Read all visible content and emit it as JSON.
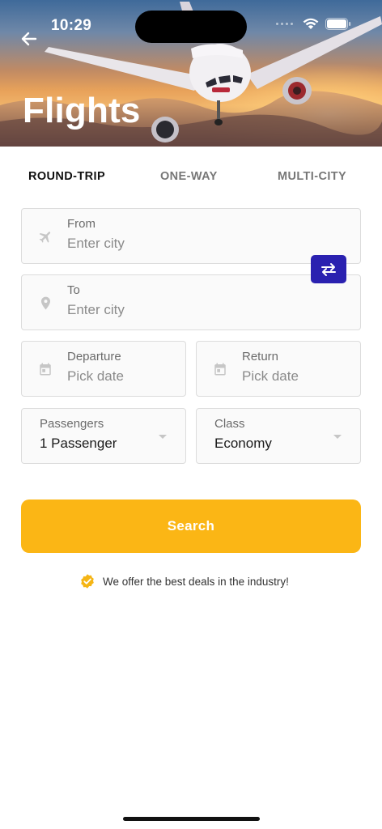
{
  "status_bar": {
    "time": "10:29"
  },
  "header": {
    "title": "Flights"
  },
  "tabs": [
    {
      "label": "ROUND-TRIP",
      "active": true
    },
    {
      "label": "ONE-WAY",
      "active": false
    },
    {
      "label": "MULTI-CITY",
      "active": false
    }
  ],
  "form": {
    "from": {
      "label": "From",
      "placeholder": "Enter city",
      "icon": "plane-icon"
    },
    "to": {
      "label": "To",
      "placeholder": "Enter city",
      "icon": "location-pin-icon"
    },
    "departure": {
      "label": "Departure",
      "placeholder": "Pick date",
      "icon": "calendar-icon"
    },
    "return": {
      "label": "Return",
      "placeholder": "Pick date",
      "icon": "calendar-icon"
    },
    "passengers": {
      "label": "Passengers",
      "value": "1 Passenger"
    },
    "class": {
      "label": "Class",
      "value": "Economy"
    },
    "swap_icon": "swap-arrows-icon"
  },
  "search_button": {
    "label": "Search"
  },
  "deal": {
    "text": "We offer the best deals in the industry!",
    "icon": "verified-badge-icon"
  },
  "colors": {
    "accent": "#fbb615",
    "swap": "#2a21b0",
    "badge": "#f5b515"
  }
}
